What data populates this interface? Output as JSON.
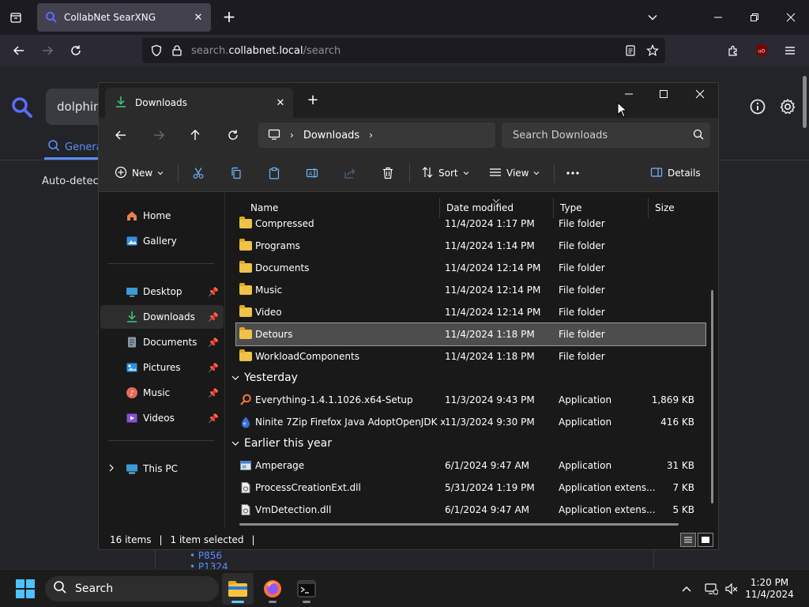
{
  "browser": {
    "tab_title": "CollabNet SearXNG",
    "url_prefix": "search.",
    "url_domain": "collabnet.local",
    "url_path": "/search"
  },
  "page": {
    "query_partial": "dolphin",
    "category_general": "General",
    "language_label": "Auto-detect",
    "links": [
      "P856",
      "P1324"
    ]
  },
  "explorer": {
    "tab_title": "Downloads",
    "breadcrumb": "Downloads",
    "search_placeholder": "Search Downloads",
    "toolbar": {
      "new": "New",
      "sort": "Sort",
      "view": "View",
      "details": "Details"
    },
    "nav": [
      {
        "label": "Home",
        "icon": "home-icon"
      },
      {
        "label": "Gallery",
        "icon": "gallery-icon"
      },
      {
        "label": "Desktop",
        "icon": "desktop-icon",
        "pinned": true
      },
      {
        "label": "Downloads",
        "icon": "download-icon",
        "pinned": true,
        "selected": true
      },
      {
        "label": "Documents",
        "icon": "document-icon",
        "pinned": true
      },
      {
        "label": "Pictures",
        "icon": "pictures-icon",
        "pinned": true
      },
      {
        "label": "Music",
        "icon": "music-icon",
        "pinned": true
      },
      {
        "label": "Videos",
        "icon": "videos-icon",
        "pinned": true
      },
      {
        "label": "This PC",
        "icon": "pc-icon"
      }
    ],
    "columns": {
      "name": "Name",
      "date": "Date modified",
      "type": "Type",
      "size": "Size"
    },
    "groups": {
      "yesterday": "Yesterday",
      "earlier": "Earlier this year"
    },
    "files": [
      {
        "name": "Compressed",
        "date": "11/4/2024 1:17 PM",
        "type": "File folder",
        "size": ""
      },
      {
        "name": "Programs",
        "date": "11/4/2024 1:14 PM",
        "type": "File folder",
        "size": ""
      },
      {
        "name": "Documents",
        "date": "11/4/2024 12:14 PM",
        "type": "File folder",
        "size": ""
      },
      {
        "name": "Music",
        "date": "11/4/2024 12:14 PM",
        "type": "File folder",
        "size": ""
      },
      {
        "name": "Video",
        "date": "11/4/2024 12:14 PM",
        "type": "File folder",
        "size": ""
      },
      {
        "name": "Detours",
        "date": "11/4/2024 1:18 PM",
        "type": "File folder",
        "size": "",
        "selected": true
      },
      {
        "name": "WorkloadComponents",
        "date": "11/4/2024 1:18 PM",
        "type": "File folder",
        "size": ""
      },
      {
        "name": "Everything-1.4.1.1026.x64-Setup",
        "date": "11/3/2024 9:43 PM",
        "type": "Application",
        "size": "1,869 KB"
      },
      {
        "name": "Ninite 7Zip Firefox Java AdoptOpenJDK x...",
        "date": "11/3/2024 9:30 PM",
        "type": "Application",
        "size": "416 KB"
      },
      {
        "name": "Amperage",
        "date": "6/1/2024 9:47 AM",
        "type": "Application",
        "size": "31 KB"
      },
      {
        "name": "ProcessCreationExt.dll",
        "date": "5/31/2024 1:19 PM",
        "type": "Application extens...",
        "size": "7 KB"
      },
      {
        "name": "VmDetection.dll",
        "date": "6/1/2024 9:47 AM",
        "type": "Application extens...",
        "size": "5 KB"
      }
    ],
    "status": {
      "items": "16 items",
      "selected": "1 item selected"
    }
  },
  "taskbar": {
    "search_label": "Search",
    "time": "1:20 PM",
    "date": "11/4/2024"
  }
}
